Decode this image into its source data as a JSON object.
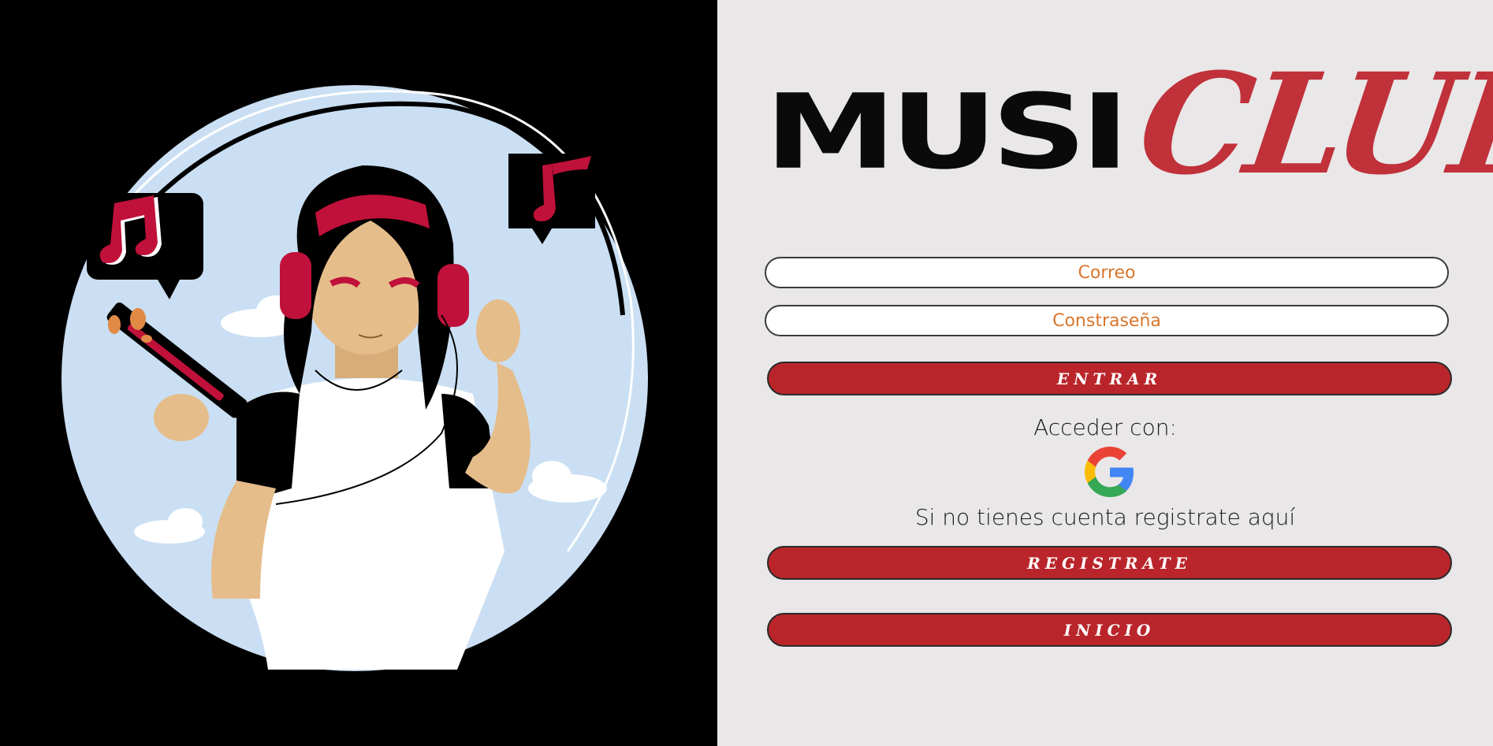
{
  "brand": {
    "part1": "MUSI",
    "part2": "CLUB"
  },
  "form": {
    "email_placeholder": "Correo",
    "password_placeholder": "Constraseña",
    "login_button": "ENTRAR",
    "access_with_label": "Acceder con:",
    "register_prompt": "Si no tienes cuenta registrate aquí",
    "register_button": "REGISTRATE",
    "home_button": "INICIO"
  },
  "colors": {
    "left_bg": "#000000",
    "right_bg": "#e9e7e8",
    "accent_red": "#b9252a",
    "logo_red": "#c0313a",
    "placeholder_orange": "#d9762b"
  },
  "icons": {
    "illustration": "girl-with-headphones-illustration",
    "google": "google-icon"
  }
}
